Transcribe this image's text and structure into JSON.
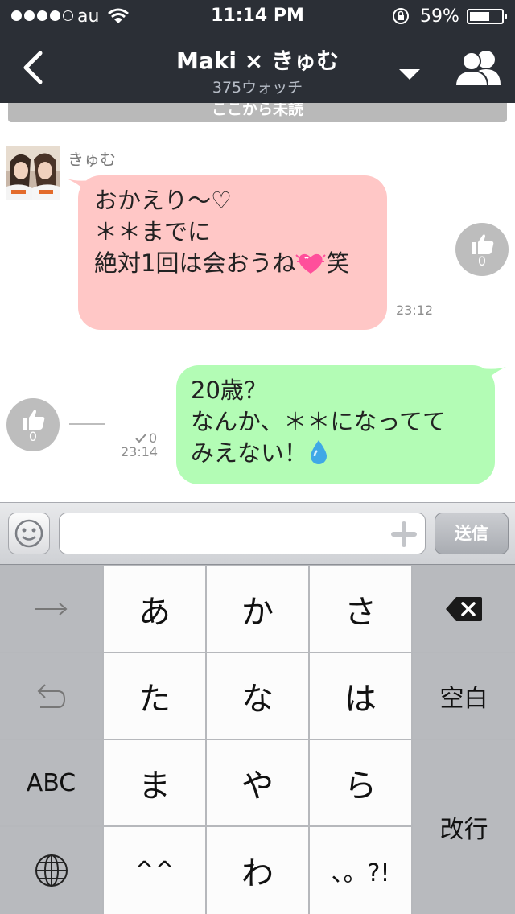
{
  "status_bar": {
    "carrier": "au",
    "time": "11:14 PM",
    "battery_percent": "59%",
    "battery_level": 0.59,
    "signal_bars": 4,
    "signal_total": 5
  },
  "nav": {
    "title": "Maki × きゅむ",
    "subtitle": "375ウォッチ"
  },
  "chat": {
    "unread_divider": "ここから未読",
    "incoming": {
      "sender": "きゅむ",
      "lines": [
        "おかえり〜♡",
        "",
        "＊＊までに",
        "絶対1回は会おうね"
      ],
      "suffix": "笑",
      "time": "23:12",
      "likes": "0"
    },
    "outgoing": {
      "lines": [
        "20歳？",
        "なんか、＊＊になってて",
        "みえない！"
      ],
      "time": "23:14",
      "read_count": "0",
      "likes": "0"
    }
  },
  "input": {
    "placeholder": "",
    "send_label": "送信"
  },
  "keyboard": {
    "row1": [
      "→",
      "あ",
      "か",
      "さ",
      "delete"
    ],
    "row2": [
      "undo",
      "た",
      "な",
      "は",
      "空白"
    ],
    "row3": [
      "ABC",
      "ま",
      "や",
      "ら",
      "改行"
    ],
    "row4": [
      "globe",
      "^^",
      "わ",
      "、。?!"
    ],
    "keys": {
      "next": "→",
      "a": "あ",
      "ka": "か",
      "sa": "さ",
      "ta": "た",
      "na": "な",
      "ha": "は",
      "space": "空白",
      "abc": "ABC",
      "ma": "ま",
      "ya": "や",
      "ra": "ら",
      "enter": "改行",
      "kaomoji": "^^",
      "wa": "わ",
      "punct": "、。?!"
    }
  },
  "colors": {
    "bar_bg": "#2b2f36",
    "incoming_bubble": "#ffc7c6",
    "outgoing_bubble": "#b3fcb5",
    "like_button": "#bdbdbd"
  }
}
